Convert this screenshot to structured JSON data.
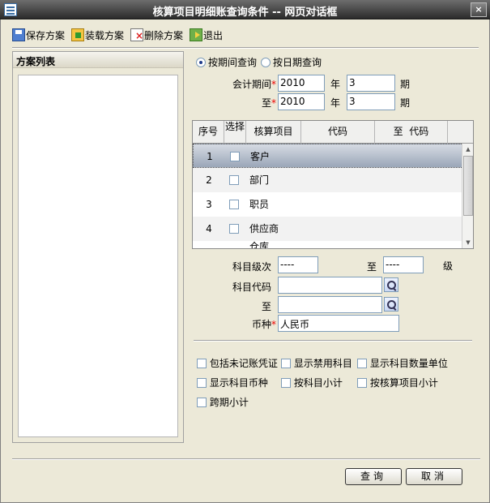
{
  "window": {
    "title": "核算项目明细账查询条件 -- 网页对话框",
    "close_glyph": "×"
  },
  "toolbar": {
    "save": {
      "label": "保存方案",
      "icon": "save-icon"
    },
    "load": {
      "label": "装载方案",
      "icon": "load-icon"
    },
    "delete": {
      "label": "删除方案",
      "icon": "delete-icon"
    },
    "exit": {
      "label": "退出",
      "icon": "exit-icon"
    }
  },
  "scheme_panel": {
    "title": "方案列表"
  },
  "query_mode": {
    "by_period": "按期间查询",
    "by_date": "按日期查询",
    "selected": "by_period"
  },
  "period": {
    "from_label": "会计期间",
    "to_label": "至",
    "from_year": "2010",
    "from_period": "3",
    "to_year": "2010",
    "to_period": "3",
    "year_unit": "年",
    "period_unit": "期"
  },
  "grid": {
    "columns": [
      "序号",
      "选择",
      "核算项目",
      "代码",
      "至  代码"
    ],
    "rows": [
      {
        "no": "1",
        "item": "客户"
      },
      {
        "no": "2",
        "item": "部门"
      },
      {
        "no": "3",
        "item": "职员"
      },
      {
        "no": "4",
        "item": "供应商"
      }
    ],
    "partial_row_text": "仓库"
  },
  "account": {
    "level_label": "科目级次",
    "level_from": "----",
    "level_to_label": "至",
    "level_to": "----",
    "level_unit": "级",
    "code_label": "科目代码",
    "code_from": "",
    "code_to_label": "至",
    "code_to": "",
    "currency_label": "币种",
    "currency": "人民币"
  },
  "options": [
    "包括未记账凭证",
    "显示禁用科目",
    "显示科目数量单位",
    "显示科目币种",
    "按科目小计",
    "按核算项目小计",
    "跨期小计"
  ],
  "buttons": {
    "query": "查询",
    "cancel": "取消"
  },
  "colors": {
    "required": "#e00000",
    "title_bar": "#3d3d3d",
    "selected_row": "#9aa6b8"
  }
}
